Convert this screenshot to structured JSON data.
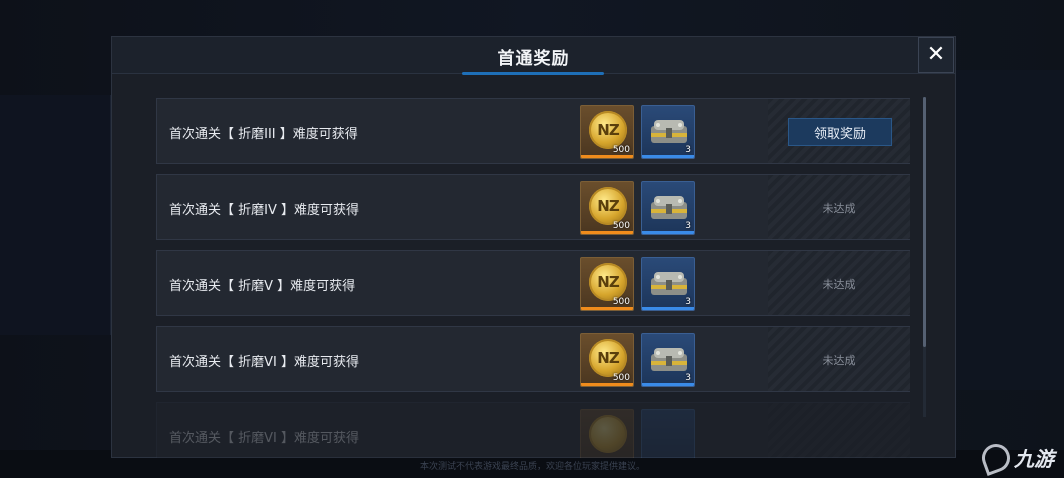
{
  "modal": {
    "title": "首通奖励",
    "close_symbol": "✕"
  },
  "rows": [
    {
      "text": "首次通关【 折磨III 】难度可获得",
      "rewards": [
        {
          "icon": "nz-coin-icon",
          "count": "500"
        },
        {
          "icon": "supply-chest-icon",
          "count": "3"
        }
      ],
      "action": {
        "type": "button",
        "label": "领取奖励"
      }
    },
    {
      "text": "首次通关【 折磨IV 】难度可获得",
      "rewards": [
        {
          "icon": "nz-coin-icon",
          "count": "500"
        },
        {
          "icon": "supply-chest-icon",
          "count": "3"
        }
      ],
      "action": {
        "type": "status",
        "label": "未达成"
      }
    },
    {
      "text": "首次通关【 折磨V 】难度可获得",
      "rewards": [
        {
          "icon": "nz-coin-icon",
          "count": "500"
        },
        {
          "icon": "supply-chest-icon",
          "count": "3"
        }
      ],
      "action": {
        "type": "status",
        "label": "未达成"
      }
    },
    {
      "text": "首次通关【 折磨VI 】难度可获得",
      "rewards": [
        {
          "icon": "nz-coin-icon",
          "count": "500"
        },
        {
          "icon": "supply-chest-icon",
          "count": "3"
        }
      ],
      "action": {
        "type": "status",
        "label": "未达成"
      }
    },
    {
      "text": "首次通关【 折磨VI 】难度可获得",
      "rewards": [],
      "action": {
        "type": "status",
        "label": ""
      }
    }
  ],
  "coin_letters": "NZ",
  "footer_text": "本次测试不代表游戏最终品质，欢迎各位玩家提供建议。",
  "watermark": {
    "text": "九游"
  },
  "colors": {
    "coin_bar": "#f08c1c",
    "chest_bar": "#3a8be8",
    "title_accent": "#1e6fb8",
    "claim_button": "#1c3a5e"
  }
}
